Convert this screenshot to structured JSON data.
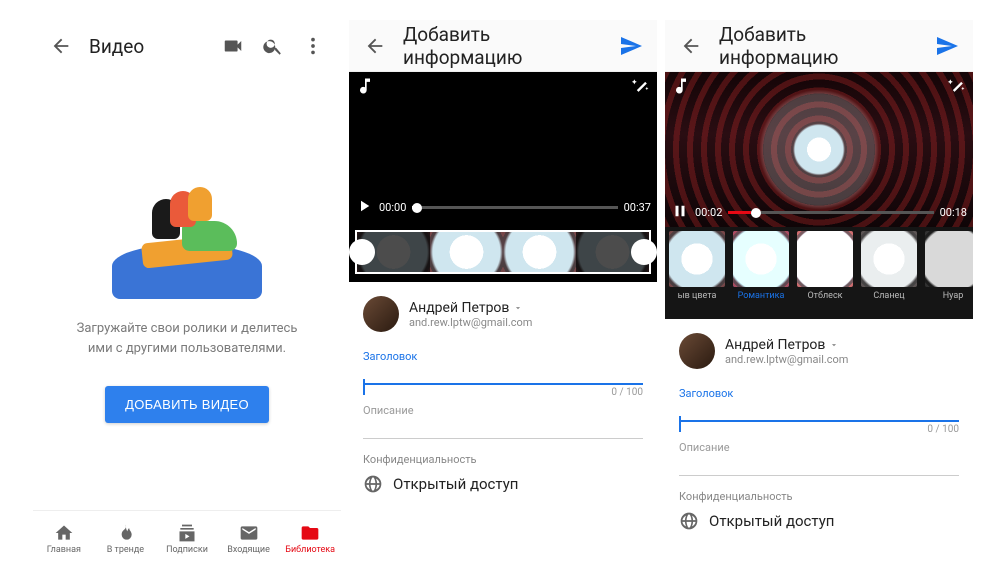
{
  "screen1": {
    "title": "Видео",
    "message": "Загружайте свои ролики и делитесь ими с другими пользователями.",
    "add_button": "ДОБАВИТЬ ВИДЕО",
    "nav": {
      "home": "Главная",
      "trending": "В тренде",
      "subs": "Подписки",
      "inbox": "Входящие",
      "library": "Библиотека"
    }
  },
  "screen2": {
    "title": "Добавить информацию",
    "time_current": "00:00",
    "time_total": "00:37",
    "user": {
      "name": "Андрей Петров",
      "email": "and.rew.lptw@gmail.com"
    },
    "title_field": {
      "label": "Заголовок",
      "value": "",
      "counter": "0 / 100"
    },
    "desc_field": {
      "label": "Описание"
    },
    "privacy": {
      "section": "Конфиденциальность",
      "value": "Открытый доступ"
    }
  },
  "screen3": {
    "title": "Добавить информацию",
    "time_current": "00:02",
    "time_total": "00:18",
    "filters": {
      "f1": "ыв цвета",
      "f2": "Романтика",
      "f3": "Отблеск",
      "f4": "Сланец",
      "f5": "Нуар"
    },
    "user": {
      "name": "Андрей Петров",
      "email": "and.rew.lptw@gmail.com"
    },
    "title_field": {
      "label": "Заголовок",
      "value": "",
      "counter": "0 / 100"
    },
    "desc_field": {
      "label": "Описание"
    },
    "privacy": {
      "section": "Конфиденциальность",
      "value": "Открытый доступ"
    }
  }
}
